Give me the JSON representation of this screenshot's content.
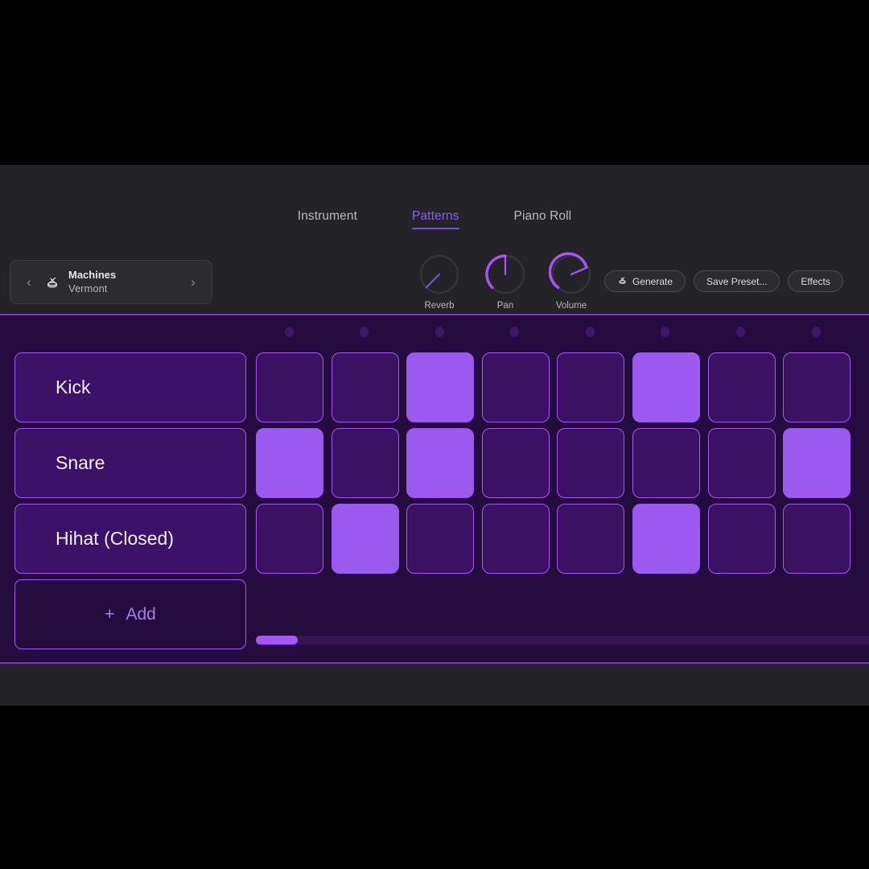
{
  "tabs": [
    {
      "label": "Instrument",
      "active": false
    },
    {
      "label": "Patterns",
      "active": true
    },
    {
      "label": "Piano Roll",
      "active": false
    }
  ],
  "preset": {
    "prev_icon": "chevron-left-icon",
    "next_icon": "chevron-right-icon",
    "icon": "drum-icon",
    "name": "Machines",
    "sub": "Vermont"
  },
  "knobs": [
    {
      "label": "Reverb",
      "value": 0,
      "icon": "knob-dial"
    },
    {
      "label": "Pan",
      "value": 50,
      "icon": "knob-dial"
    },
    {
      "label": "Volume",
      "value": 75,
      "icon": "knob-dial"
    }
  ],
  "actions": [
    {
      "label": "Generate",
      "icon": "drum-icon"
    },
    {
      "label": "Save Preset...",
      "icon": null
    },
    {
      "label": "Effects",
      "icon": null
    }
  ],
  "sequencer": {
    "step_count": 8,
    "tracks": [
      {
        "name": "Kick",
        "steps": [
          0,
          0,
          1,
          0,
          0,
          1,
          0,
          0
        ]
      },
      {
        "name": "Snare",
        "steps": [
          1,
          0,
          1,
          0,
          0,
          0,
          0,
          1
        ]
      },
      {
        "name": "Hihat (Closed)",
        "steps": [
          0,
          1,
          0,
          0,
          0,
          1,
          0,
          0
        ]
      }
    ],
    "add_label": "Add",
    "add_plus": "+",
    "scroll_position_pct": 0
  },
  "colors": {
    "accent": "#a855f7",
    "step_on": "#9B59F0",
    "step_off": "#3A1163",
    "panel_bg": "#240D3E",
    "tab_active": "#8b5cf6"
  }
}
